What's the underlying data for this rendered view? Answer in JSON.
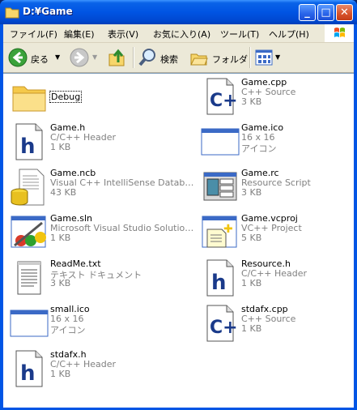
{
  "window": {
    "title": "D:¥Game",
    "minimize_label": "_",
    "maximize_label": "□",
    "close_label": "✕"
  },
  "menu": {
    "items": [
      "ファイル(F)",
      "編集(E)",
      "表示(V)",
      "お気に入り(A)",
      "ツール(T)",
      "ヘルプ(H)"
    ]
  },
  "toolbar": {
    "back_label": "戻る",
    "search_label": "検索",
    "folders_label": "フォルダ"
  },
  "files": [
    {
      "name": "Debug",
      "desc": "",
      "size": "",
      "icon": "folder-icon"
    },
    {
      "name": "Game.cpp",
      "desc": "C++ Source",
      "size": "3 KB",
      "icon": "cpp-file-icon"
    },
    {
      "name": "Game.h",
      "desc": "C/C++ Header",
      "size": "1 KB",
      "icon": "header-file-icon"
    },
    {
      "name": "Game.ico",
      "desc": "16 x 16",
      "size": "アイコン",
      "icon": "ico-file-icon"
    },
    {
      "name": "Game.ncb",
      "desc": "Visual C++ IntelliSense Database",
      "size": "43 KB",
      "icon": "ncb-file-icon"
    },
    {
      "name": "Game.rc",
      "desc": "Resource Script",
      "size": "3 KB",
      "icon": "rc-file-icon"
    },
    {
      "name": "Game.sln",
      "desc": "Microsoft Visual Studio Solution ...",
      "size": "1 KB",
      "icon": "sln-file-icon"
    },
    {
      "name": "Game.vcproj",
      "desc": "VC++ Project",
      "size": "5 KB",
      "icon": "vcproj-file-icon"
    },
    {
      "name": "ReadMe.txt",
      "desc": "テキスト ドキュメント",
      "size": "3 KB",
      "icon": "text-file-icon"
    },
    {
      "name": "Resource.h",
      "desc": "C/C++ Header",
      "size": "1 KB",
      "icon": "header-file-icon"
    },
    {
      "name": "small.ico",
      "desc": "16 x 16",
      "size": "アイコン",
      "icon": "ico-file-icon"
    },
    {
      "name": "stdafx.cpp",
      "desc": "C++ Source",
      "size": "1 KB",
      "icon": "cpp-file-icon"
    },
    {
      "name": "stdafx.h",
      "desc": "C/C++ Header",
      "size": "1 KB",
      "icon": "header-file-icon"
    }
  ]
}
